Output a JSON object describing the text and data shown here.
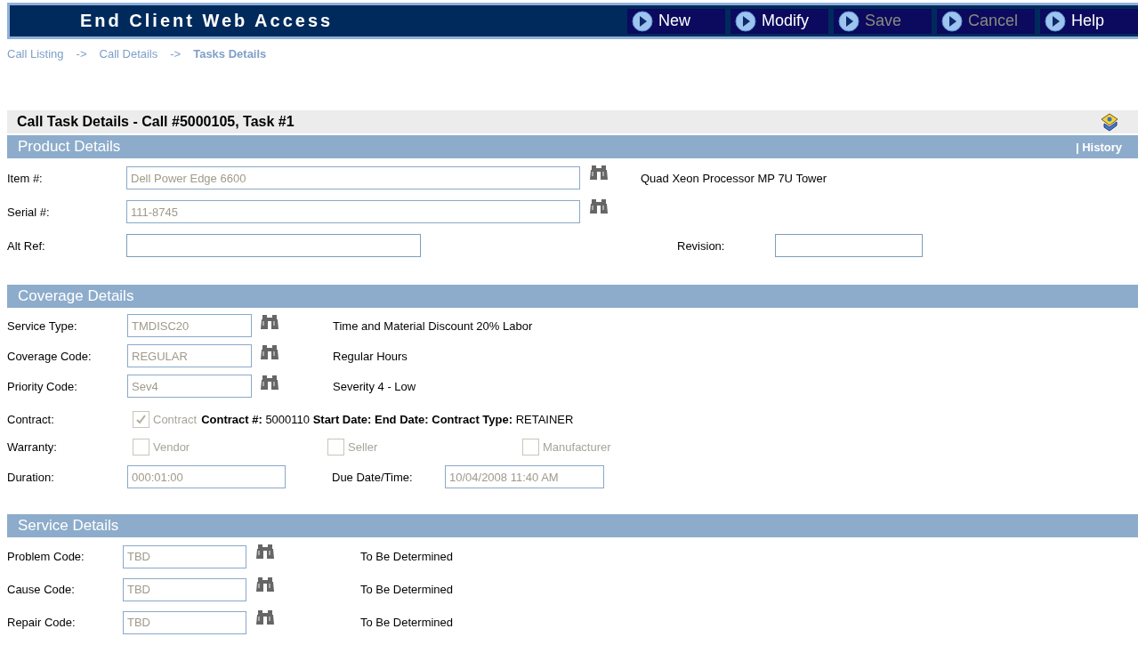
{
  "header": {
    "title": "End Client Web Access",
    "buttons": [
      {
        "label": "New",
        "disabled": false
      },
      {
        "label": "Modify",
        "disabled": false
      },
      {
        "label": "Save",
        "disabled": true
      },
      {
        "label": "Cancel",
        "disabled": true
      },
      {
        "label": "Help",
        "disabled": false
      }
    ]
  },
  "breadcrumb": [
    {
      "label": "Call Listing",
      "selected": false
    },
    {
      "separator": "->"
    },
    {
      "label": "Call Details",
      "selected": false
    },
    {
      "separator": "->"
    },
    {
      "label": "Tasks Details",
      "selected": true
    }
  ],
  "title": "Call Task Details - Call #5000105, Task #1",
  "sections": [
    {
      "title": "Product Details",
      "link": "| History",
      "rows": [
        {
          "kind": "lookup",
          "label": "Item #:",
          "value": "Dell Power Edge 6600",
          "disabled": true,
          "description": "Quad Xeon Processor MP 7U Tower"
        },
        {
          "kind": "lookup",
          "label": "Serial #:",
          "value": "111-8745",
          "disabled": true
        },
        {
          "kind": "pair",
          "label": "Alt Ref:",
          "disabled": false,
          "label2": "Revision:",
          "disabled2": false
        }
      ]
    },
    {
      "title": "Coverage Details",
      "rows": [
        {
          "kind": "lookup",
          "label": "Service Type:",
          "value": "TMDISC20",
          "disabled": true,
          "description": "Time and Material Discount 20% Labor"
        },
        {
          "kind": "lookup",
          "label": "Coverage Code:",
          "value": "REGULAR",
          "disabled": true,
          "description": "Regular Hours"
        },
        {
          "kind": "lookup",
          "label": "Priority Code:",
          "value": "Sev4",
          "disabled": true,
          "description": "Severity 4 - Low"
        },
        {
          "kind": "checks",
          "label": "Contract:",
          "checks": [
            {
              "label": "Contract",
              "checked": true,
              "disabled": true
            }
          ],
          "info": "**Contract #:** 5000110 **Start Date: End Date: Contract Type:** RETAINER"
        },
        {
          "kind": "checks",
          "label": "Warranty:",
          "checks": [
            {
              "label": "Vendor",
              "checked": false,
              "disabled": true
            },
            {
              "label": "Seller",
              "checked": false,
              "disabled": true
            },
            {
              "label": "Manufacturer",
              "checked": false,
              "disabled": true
            }
          ]
        },
        {
          "kind": "pair",
          "label": "Duration:",
          "value": "000:01:00",
          "disabled": true,
          "label2": "Due Date/Time:",
          "value2": "10/04/2008 11:40 AM",
          "disabled2": true
        }
      ]
    },
    {
      "title": "Service Details",
      "rows": [
        {
          "kind": "lookup",
          "label": "Problem Code:",
          "value": "TBD",
          "disabled": true,
          "description": "To Be Determined"
        },
        {
          "kind": "lookup",
          "label": "Cause Code:",
          "value": "TBD",
          "disabled": true,
          "description": "To Be Determined"
        },
        {
          "kind": "lookup",
          "label": "Repair Code:",
          "value": "TBD",
          "disabled": true,
          "description": "To Be Determined"
        }
      ]
    }
  ]
}
